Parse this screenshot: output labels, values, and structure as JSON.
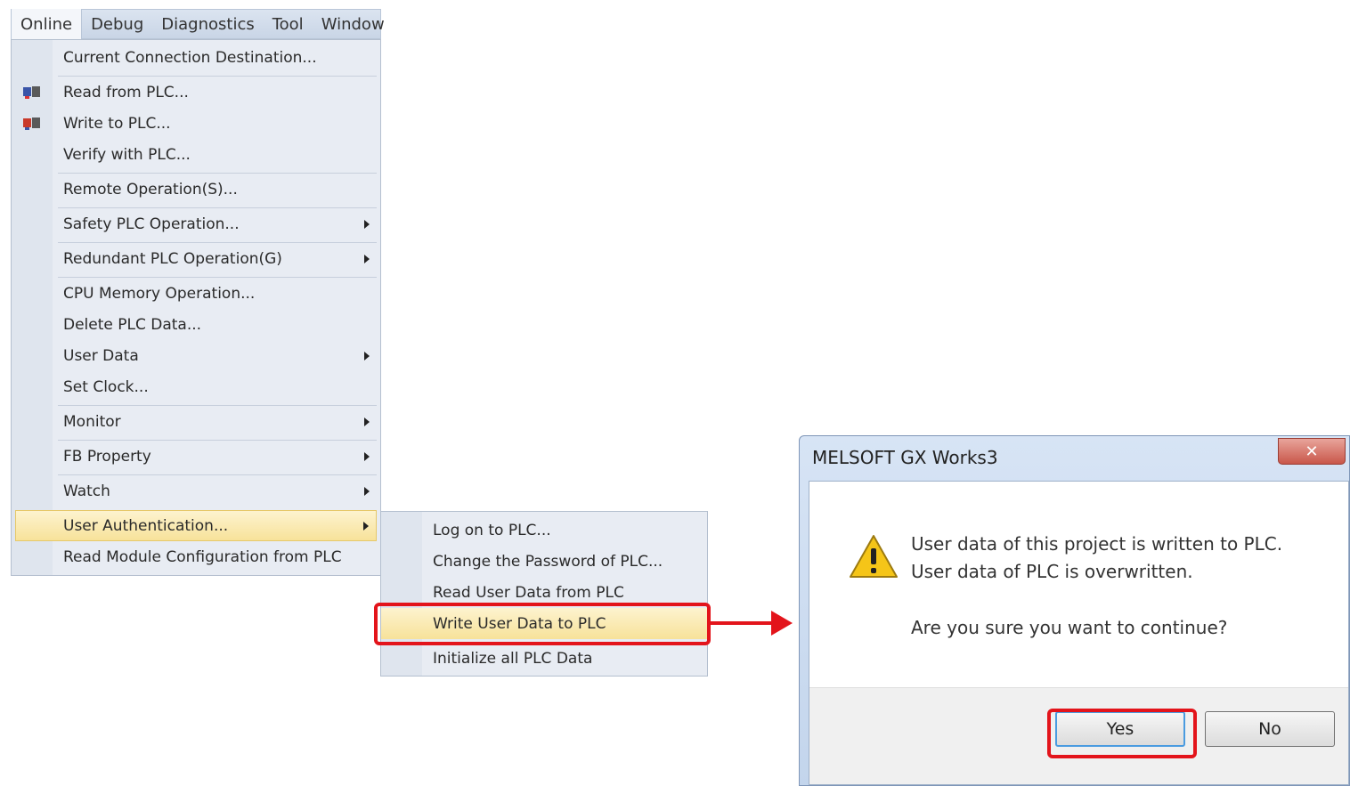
{
  "menubar": {
    "items": [
      "Online",
      "Debug",
      "Diagnostics",
      "Tool",
      "Window"
    ]
  },
  "menu": {
    "items": [
      {
        "label": "Current Connection Destination...",
        "arrow": false,
        "icon": ""
      },
      {
        "label": "Read from PLC...",
        "arrow": false,
        "icon": "read-plc-icon"
      },
      {
        "label": "Write to PLC...",
        "arrow": false,
        "icon": "write-plc-icon"
      },
      {
        "label": "Verify with PLC...",
        "arrow": false,
        "icon": ""
      },
      {
        "label": "Remote Operation(S)...",
        "arrow": false,
        "icon": ""
      },
      {
        "label": "Safety PLC Operation...",
        "arrow": true,
        "icon": ""
      },
      {
        "label": "Redundant PLC Operation(G)",
        "arrow": true,
        "icon": ""
      },
      {
        "label": "CPU Memory Operation...",
        "arrow": false,
        "icon": ""
      },
      {
        "label": "Delete PLC Data...",
        "arrow": false,
        "icon": ""
      },
      {
        "label": "User Data",
        "arrow": true,
        "icon": ""
      },
      {
        "label": "Set Clock...",
        "arrow": false,
        "icon": ""
      },
      {
        "label": "Monitor",
        "arrow": true,
        "icon": ""
      },
      {
        "label": "FB Property",
        "arrow": true,
        "icon": ""
      },
      {
        "label": "Watch",
        "arrow": true,
        "icon": ""
      },
      {
        "label": "User Authentication...",
        "arrow": true,
        "icon": "",
        "highlighted": true
      },
      {
        "label": "Read Module Configuration from PLC",
        "arrow": false,
        "icon": ""
      }
    ]
  },
  "submenu": {
    "items": [
      {
        "label": "Log on to PLC..."
      },
      {
        "label": "Change the Password of PLC..."
      },
      {
        "label": "Read User Data from PLC"
      },
      {
        "label": "Write User Data to PLC",
        "highlighted": true
      },
      {
        "label": "Initialize all PLC Data"
      }
    ]
  },
  "dialog": {
    "title": "MELSOFT GX Works3",
    "close_label": "✕",
    "message_line1": "User data of this project is written to PLC.",
    "message_line2": "User data of PLC is overwritten.",
    "question": "Are you sure you want to continue?",
    "yes_label": "Yes",
    "no_label": "No"
  },
  "colors": {
    "highlight_box": "#e3141b",
    "menu_highlight": "#f7e29a"
  }
}
